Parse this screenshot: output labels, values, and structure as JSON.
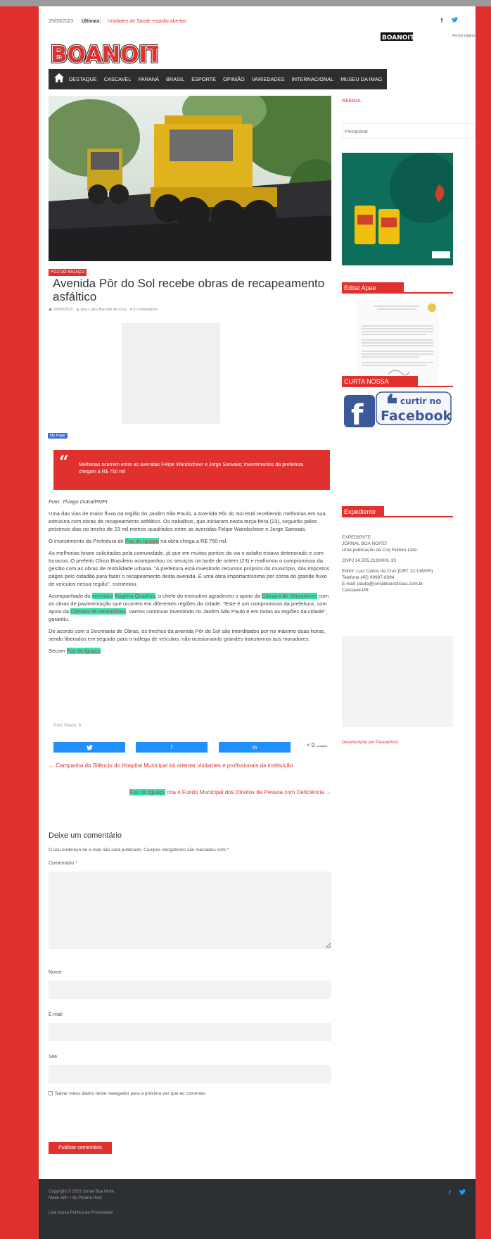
{
  "topbar": {
    "date": "25/05/2023",
    "latest_label": "Últimas:",
    "latest_news": "Unidades de Saúde estarão abertas",
    "facebook_icon": "f",
    "twitter_icon": "t"
  },
  "header": {
    "logo_text": "BOANOITE!",
    "small_logo_text": "BOANOITE!",
    "corner_text": "Fechar página"
  },
  "nav": {
    "home_icon": "home-icon",
    "items": [
      "DESTAQUE",
      "CASCAVEL",
      "PARANÁ",
      "BRASIL",
      "ESPORTE",
      "OPINIÃO",
      "VARIEDADES",
      "INTERNACIONAL",
      "MUSEU DA IMAG"
    ]
  },
  "article": {
    "category": "FOZ DO IGUAÇU",
    "title": "Avenida Pôr do Sol recebe obras de recapeamento asfáltico",
    "date": "25/05/2023",
    "author": "Ana Luiza Barcelo da Cruz",
    "comments": "0 comentários",
    "my_page": "My Page",
    "quote": "Melhorias ocorrem entre as avenidas Felipe Wandscheer e Jorge Sanwais; investimentos da prefeitura chegam a R$ 750 mil",
    "photo_credit": "Foto: Thiago Dutra/PMFI.",
    "p1": "Uma das vias de maior fluxo da região do Jardim São Paulo, a Avenida Pôr do Sol está recebendo melhorias em sua estrutura com obras de recapeamento asfáltico. Os trabalhos, que iniciaram nesta terça-feira (23), seguirão pelos próximos dias no trecho de 23 mil metros quadrados entre as avenidas Felipe Wandscheer e Jorge Sanwais.",
    "p2_a": "O investimento da Prefeitura de ",
    "p2_link": "Foz do Iguaçu",
    "p2_b": " na obra chega a R$ 750 mil.",
    "p3": "As melhorias foram solicitadas pela comunidade, já que em muitos pontos da via o asfalto estava deteriorado e com buracos. O prefeito Chico Brasileiro acompanhou os serviços na tarde de ontem (23) e reafirmou o compromisso da gestão com as obras de mobilidade urbana. \"A prefeitura está investindo recursos próprios do município, dos impostos pagos pelo cidadão para fazer o recapeamento desta avenida. É uma obra importantíssima por conta do grande fluxo de veículos nessa região\", comentou.",
    "p4_a": "Acompanhado do ",
    "p4_l1": "vereador",
    "p4_l2": "Rogério Quadros",
    "p4_b": ", o chefe do executivo agradeceu o apoio da ",
    "p4_l3": "Câmara de Vereadores",
    "p4_c": " com as obras de pavimentação que ocorrem em diferentes regiões da cidade. \"Este é um compromisso da prefeitura, com apoio da ",
    "p4_l4": "Câmara de Vereadores",
    "p4_d": ". Vamos continuar investindo no Jardim São Paulo e em todas as regiões da cidade\", garantiu.",
    "p5": "De acordo com a Secretaria de Obras, os trechos da avenida Pôr do Sol são interditados por no máximo duas horas, sendo liberados em seguida para o tráfego de veículos, não ocasionando grandes transtornos aos moradores.",
    "p6_a": "Secom ",
    "p6_link": "Foz do Iguaçu",
    "post_views": "Post Views: 6",
    "share_count": "0",
    "share_count_label": "Compart."
  },
  "post_nav": {
    "prev": "← Campanha do Silêncio do Hospital Municipal irá orientar visitantes e profissionais da instituição",
    "next_link": "Foz do Iguaçu",
    "next_rest": " cria o Fundo Municipal dos Direitos da Pessoa com Deficiência →"
  },
  "comments": {
    "heading": "Deixe um comentário",
    "note": "O seu endereço de e-mail não será publicado. Campos obrigatórios são marcados com *",
    "comment_label": "Comentário",
    "name_label": "Nome",
    "email_label": "E-mail",
    "site_label": "Site",
    "save_label": "Salvar meus dados neste navegador para a próxima vez que eu comentar.",
    "submit": "Publicar comentário"
  },
  "sidebar": {
    "webmail": "WEBMAIL",
    "search_placeholder": "Pesquisar",
    "edital_title": "Edital Apae Cantagalo",
    "fanpage_title": "CURTA NOSSA FANPAGE",
    "fb_like": "curtir no",
    "fb_brand": "Facebook",
    "expediente_title": "Expediente",
    "exp_l1": "EXPEDIENTE",
    "exp_l2": "JORNAL BOA NOITE!",
    "exp_l3": "Uma publicação da Coq Editora Ltda.",
    "exp_cnpj": "CNPJ 14.505.212/0001-33",
    "exp_editor": "Editor: Luiz Carlos da Cruz (DRT 12.136/PR)",
    "exp_phone": "Telefone (45) 99997-8394",
    "exp_email": "E-mail: pauta@jornalboanoticias.com.br",
    "exp_city": "Cascavel-PR",
    "developed": "Desenvolvido por ParanaHost"
  },
  "footer": {
    "copyright": "Copyright © 2023 Jornal Boa Noite.",
    "made_with": "Made with",
    "heart": "♥",
    "made_by": "by Parana Host",
    "policy": "Leia nossa Política de Privacidade"
  },
  "colors": {
    "brand_red": "#e0312f",
    "nav_dark": "#2e2e2e",
    "highlight": "#2de7b3",
    "footer": "#2d3033"
  }
}
